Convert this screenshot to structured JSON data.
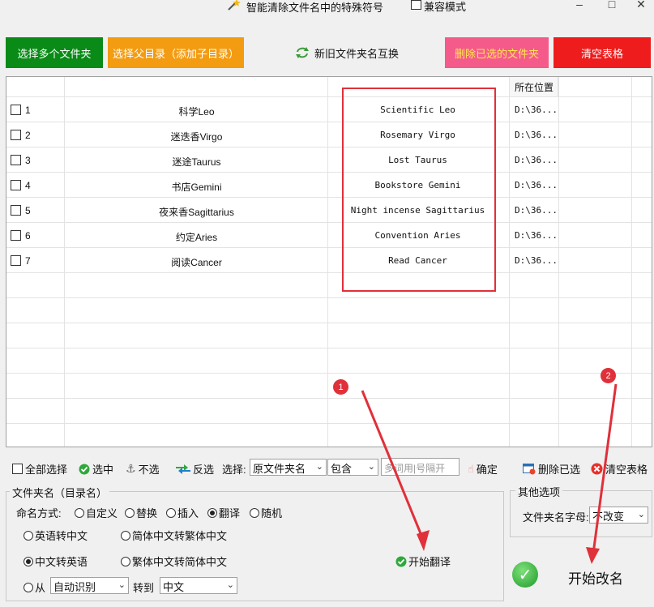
{
  "window": {
    "title": "智能清除文件名中的特殊符号",
    "compat_label": "兼容模式",
    "minimize": "–",
    "maximize": "□",
    "close": "✕"
  },
  "toolbar": {
    "select_folders": "选择多个文件夹",
    "select_parent": "选择父目录（添加子目录）",
    "swap": "新旧文件夹名互换",
    "delete_selected": "删除已选的文件夹",
    "clear_table": "清空表格"
  },
  "colors": {
    "green": "#0a8a17",
    "orange": "#f39c12",
    "pink": "#f45b8a",
    "red": "#ee1c1c",
    "annotation": "#e0303a"
  },
  "table": {
    "location_header": "所在位置",
    "rows": [
      {
        "index": "1",
        "name": "科学Leo",
        "translated": "Scientific Leo",
        "location": "D:\\36..."
      },
      {
        "index": "2",
        "name": "迷迭香Virgo",
        "translated": "Rosemary Virgo",
        "location": "D:\\36..."
      },
      {
        "index": "3",
        "name": "迷途Taurus",
        "translated": "Lost Taurus",
        "location": "D:\\36..."
      },
      {
        "index": "4",
        "name": "书店Gemini",
        "translated": "Bookstore Gemini",
        "location": "D:\\36..."
      },
      {
        "index": "5",
        "name": "夜来香Sagittarius",
        "translated": "Night incense Sagittarius",
        "location": "D:\\36..."
      },
      {
        "index": "6",
        "name": "约定Aries",
        "translated": "Convention Aries",
        "location": "D:\\36..."
      },
      {
        "index": "7",
        "name": "阅读Cancer",
        "translated": "Read Cancer",
        "location": "D:\\36..."
      }
    ]
  },
  "actions": {
    "select_all": "全部选择",
    "select": "选中",
    "deselect": "不选",
    "invert": "反选",
    "choose_label": "选择:",
    "field_value": "原文件夹名",
    "match_value": "包含",
    "keyword_placeholder": "多词用|号隔开",
    "confirm": "确定",
    "delete_selected": "删除已选",
    "clear_table": "清空表格"
  },
  "naming": {
    "group_title": "文件夹名（目录名）",
    "mode_label": "命名方式:",
    "modes": [
      "自定义",
      "替换",
      "插入",
      "翻译",
      "随机"
    ],
    "selected_mode": "翻译",
    "eng_to_cn": "英语转中文",
    "simp_to_trad": "简体中文转繁体中文",
    "cn_to_eng": "中文转英语",
    "trad_to_simp": "繁体中文转简体中文",
    "from_label": "从",
    "from_value": "自动识别",
    "to_label": "转到",
    "to_value": "中文",
    "start_translate": "开始翻译"
  },
  "other": {
    "group_title": "其他选项",
    "letter_label": "文件夹名字母:",
    "letter_value": "不改变",
    "start_rename": "开始改名"
  },
  "annotations": {
    "badge1": "1",
    "badge2": "2"
  }
}
